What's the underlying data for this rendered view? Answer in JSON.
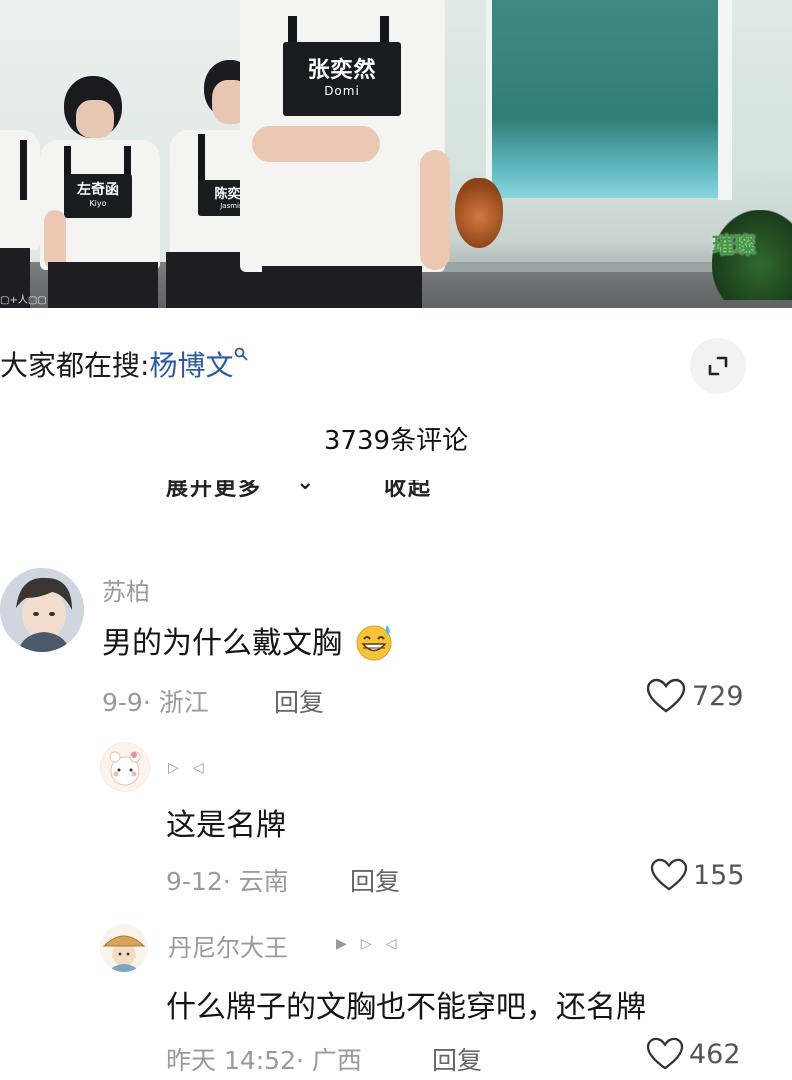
{
  "video": {
    "bib_main": {
      "name": "张奕然",
      "en": "Domi"
    },
    "bib_left": {
      "name": "左奇函",
      "en": "Kiyo"
    },
    "bib_mid": {
      "name": "陈奕恒",
      "en": "Jasmine"
    },
    "watermark": "璀璨"
  },
  "search": {
    "prefix": "大家都在搜:",
    "term": "杨博文"
  },
  "comments_header": {
    "count_label": "3739条评论",
    "expand_more": "展开更多",
    "collapse": "收起"
  },
  "comments": [
    {
      "username": "苏柏",
      "text": "男的为什么戴文胸",
      "date": "9-9",
      "location": "浙江",
      "reply_label": "回复",
      "likes": "729",
      "emoji": "grinning-sweat-emoji"
    },
    {
      "username": "",
      "text": "这是名牌",
      "date": "9-12",
      "location": "云南",
      "reply_label": "回复",
      "likes": "155"
    },
    {
      "username": "丹尼尔大王",
      "text": "什么牌子的文胸也不能穿吧，还名牌",
      "date": "昨天 14:52",
      "location": "广西",
      "reply_label": "回复",
      "likes": "462"
    }
  ],
  "colors": {
    "search_term": "#2b5aa0",
    "meta_gray": "#9a9a9a",
    "emoji_yellow": "#f7c33a"
  }
}
